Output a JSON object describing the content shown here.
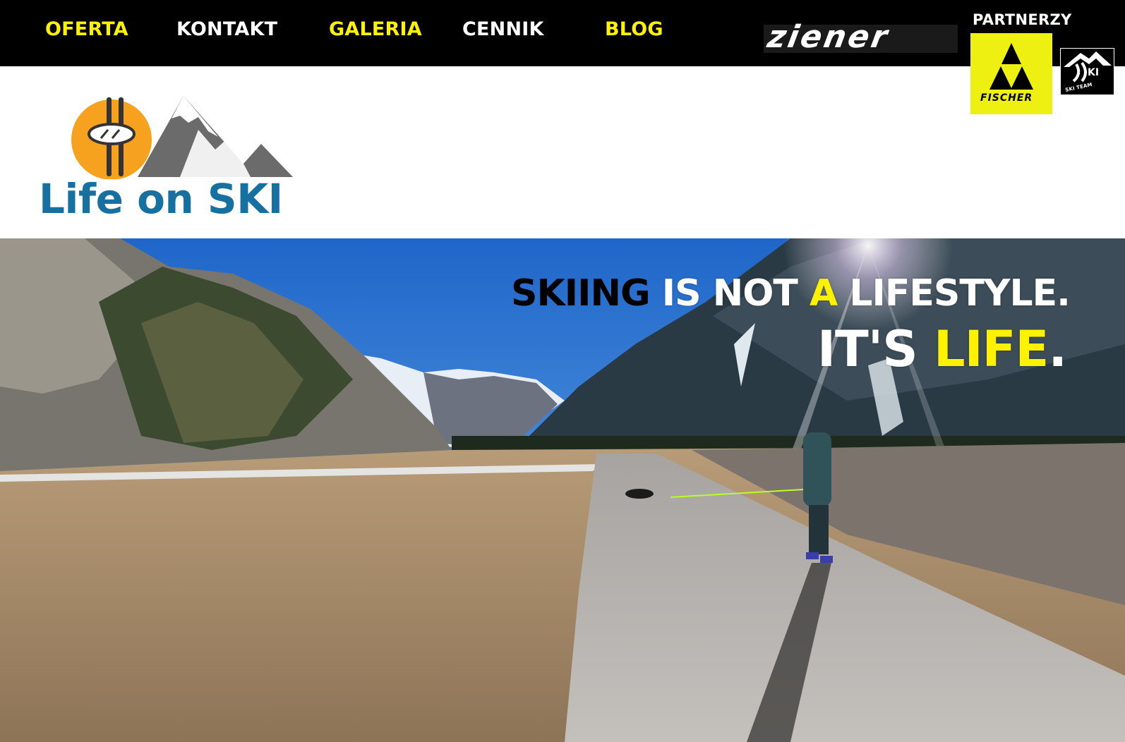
{
  "nav": {
    "items": [
      {
        "label": "OFERTA",
        "color": "#fff200"
      },
      {
        "label": "KONTAKT",
        "color": "#ffffff"
      },
      {
        "label": "GALERIA",
        "color": "#fff200"
      },
      {
        "label": "CENNIK",
        "color": "#ffffff"
      },
      {
        "label": "BLOG",
        "color": "#fff200"
      }
    ]
  },
  "partners": {
    "label": "PARTNERZY",
    "logos": [
      {
        "name": "ziener",
        "text": "ziener"
      },
      {
        "name": "fischer",
        "text": "FISCHER",
        "color": "#eef012"
      },
      {
        "name": "ski-team",
        "text": "SKI TEAM"
      }
    ]
  },
  "brand": {
    "title": "Life on SKI",
    "title_color": "#1670a0",
    "sun_color": "#f6a21e"
  },
  "hero": {
    "tagline_line1": [
      "SKIING",
      "IS",
      "NOT",
      "A",
      "LIFESTYLE."
    ],
    "tagline_line2": [
      "IT'S",
      "LIFE",
      "."
    ],
    "colors": {
      "black": "#000000",
      "white": "#ffffff",
      "yellow": "#fff200",
      "sky": "#3f8ee0"
    }
  }
}
